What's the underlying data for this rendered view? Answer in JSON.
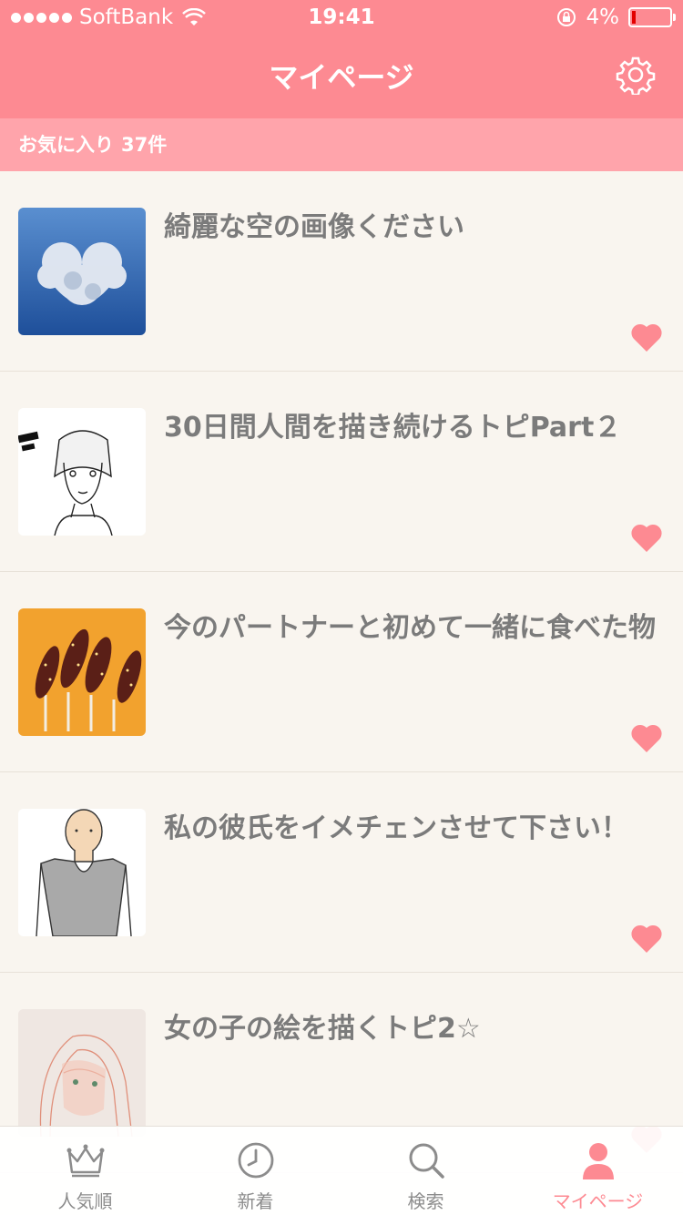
{
  "status_bar": {
    "carrier": "SoftBank",
    "time": "19:41",
    "battery": "4%",
    "battery_level": 0.04
  },
  "header": {
    "title": "マイページ",
    "settings_icon": "gear-icon"
  },
  "favorites": {
    "label": "お気に入り",
    "count": "37件"
  },
  "colors": {
    "accent": "#fd8a92",
    "subheader": "#ffa4ab",
    "background": "#f9f5ef",
    "title_text": "#7b7b7b",
    "heart": "#fd8a92"
  },
  "items": [
    {
      "title": "綺麗な空の画像ください",
      "favorited": true
    },
    {
      "title": "30日間人間を描き続けるトピPart２",
      "favorited": true
    },
    {
      "title": "今のパートナーと初めて一緒に食べた物",
      "favorited": true
    },
    {
      "title": "私の彼氏をイメチェンさせて下さい！",
      "favorited": true
    },
    {
      "title": "女の子の絵を描くトピ2☆",
      "favorited": true
    }
  ],
  "tabs": [
    {
      "label": "人気順",
      "icon": "crown-icon",
      "active": false
    },
    {
      "label": "新着",
      "icon": "clock-icon",
      "active": false
    },
    {
      "label": "検索",
      "icon": "search-icon",
      "active": false
    },
    {
      "label": "マイページ",
      "icon": "person-icon",
      "active": true
    }
  ]
}
